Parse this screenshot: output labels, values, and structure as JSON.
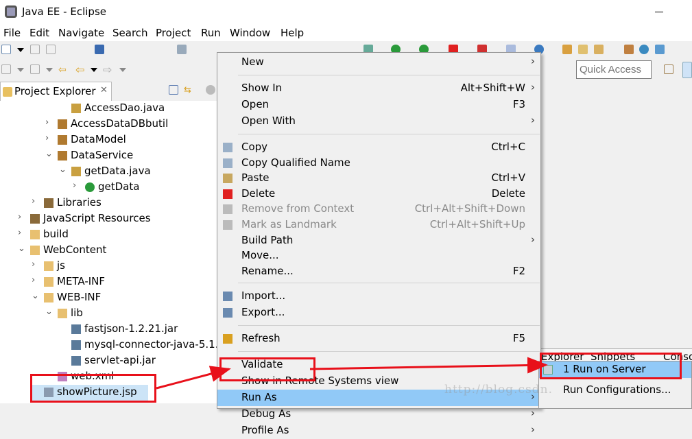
{
  "window": {
    "title": "Java EE - Eclipse"
  },
  "menubar": [
    "File",
    "Edit",
    "Navigate",
    "Search",
    "Project",
    "Run",
    "Window",
    "Help"
  ],
  "toolbar": {
    "quick_access_placeholder": "Quick Access"
  },
  "project_explorer": {
    "tab_label": "Project Explorer",
    "tree": [
      {
        "label": "AccessDao.java",
        "icon": "java-file-icon",
        "depth": 4,
        "chevron": ""
      },
      {
        "label": "AccessDataDBbutil",
        "icon": "package-icon",
        "depth": 3,
        "chevron": "›"
      },
      {
        "label": "DataModel",
        "icon": "package-icon",
        "depth": 3,
        "chevron": "›"
      },
      {
        "label": "DataService",
        "icon": "package-icon",
        "depth": 3,
        "chevron": "⌄"
      },
      {
        "label": "getData.java",
        "icon": "java-file-icon",
        "depth": 4,
        "chevron": "⌄"
      },
      {
        "label": "getData",
        "icon": "class-icon",
        "depth": 5,
        "chevron": "›"
      },
      {
        "label": "Libraries",
        "icon": "library-icon",
        "depth": 2,
        "chevron": "›"
      },
      {
        "label": "JavaScript Resources",
        "icon": "library-icon",
        "depth": 1,
        "chevron": "›"
      },
      {
        "label": "build",
        "icon": "folder-icon",
        "depth": 1,
        "chevron": "›"
      },
      {
        "label": "WebContent",
        "icon": "folder-icon",
        "depth": 1,
        "chevron": "⌄"
      },
      {
        "label": "js",
        "icon": "folder-icon",
        "depth": 2,
        "chevron": "›"
      },
      {
        "label": "META-INF",
        "icon": "folder-icon",
        "depth": 2,
        "chevron": "›"
      },
      {
        "label": "WEB-INF",
        "icon": "folder-icon",
        "depth": 2,
        "chevron": "⌄"
      },
      {
        "label": "lib",
        "icon": "folder-icon",
        "depth": 3,
        "chevron": "⌄"
      },
      {
        "label": "fastjson-1.2.21.jar",
        "icon": "jar-icon",
        "depth": 4,
        "chevron": ""
      },
      {
        "label": "mysql-connector-java-5.1.",
        "icon": "jar-icon",
        "depth": 4,
        "chevron": ""
      },
      {
        "label": "servlet-api.jar",
        "icon": "jar-icon",
        "depth": 4,
        "chevron": ""
      },
      {
        "label": "web.xml",
        "icon": "xml-file-icon",
        "depth": 3,
        "chevron": ""
      },
      {
        "label": "showPicture.jsp",
        "icon": "jsp-file-icon",
        "depth": 2,
        "chevron": "",
        "selected": true
      }
    ]
  },
  "context_menu": [
    {
      "label": "New",
      "shortcut": "",
      "submenu": true
    },
    {
      "sep": true
    },
    {
      "label": "Show In",
      "shortcut": "Alt+Shift+W",
      "submenu": true
    },
    {
      "label": "Open",
      "shortcut": "F3"
    },
    {
      "label": "Open With",
      "shortcut": "",
      "submenu": true
    },
    {
      "sep": true
    },
    {
      "label": "Copy",
      "shortcut": "Ctrl+C",
      "icon": "copy-icon"
    },
    {
      "label": "Copy Qualified Name",
      "shortcut": "",
      "icon": "copy-icon"
    },
    {
      "label": "Paste",
      "shortcut": "Ctrl+V",
      "icon": "paste-icon"
    },
    {
      "label": "Delete",
      "shortcut": "Delete",
      "icon": "delete-icon"
    },
    {
      "label": "Remove from Context",
      "shortcut": "Ctrl+Alt+Shift+Down",
      "disabled": true,
      "icon": "remove-context-icon"
    },
    {
      "label": "Mark as Landmark",
      "shortcut": "Ctrl+Alt+Shift+Up",
      "disabled": true,
      "icon": "landmark-icon"
    },
    {
      "label": "Build Path",
      "shortcut": "",
      "submenu": true
    },
    {
      "label": "Move...",
      "shortcut": ""
    },
    {
      "label": "Rename...",
      "shortcut": "F2"
    },
    {
      "sep": true
    },
    {
      "label": "Import...",
      "shortcut": "",
      "icon": "import-icon"
    },
    {
      "label": "Export...",
      "shortcut": "",
      "icon": "export-icon"
    },
    {
      "sep": true
    },
    {
      "label": "Refresh",
      "shortcut": "F5",
      "icon": "refresh-icon"
    },
    {
      "sep": true
    },
    {
      "label": "Validate",
      "shortcut": ""
    },
    {
      "label": "Show in Remote Systems view",
      "shortcut": ""
    },
    {
      "label": "Run As",
      "shortcut": "",
      "submenu": true,
      "highlighted": true
    },
    {
      "label": "Debug As",
      "shortcut": "",
      "submenu": true
    },
    {
      "label": "Profile As",
      "shortcut": "",
      "submenu": true
    }
  ],
  "background_tabs": [
    "Explorer",
    "Snippets",
    "Conso"
  ],
  "submenu": [
    {
      "label": "1 Run on Server",
      "highlighted": true,
      "icon": "run-server-icon"
    },
    {
      "label": "Run Configurations..."
    }
  ],
  "watermark": "http://blog.csdn.net/",
  "colors": {
    "highlight": "#91c9f7",
    "selection": "#cce4f7",
    "annotation": "#e8101a"
  }
}
